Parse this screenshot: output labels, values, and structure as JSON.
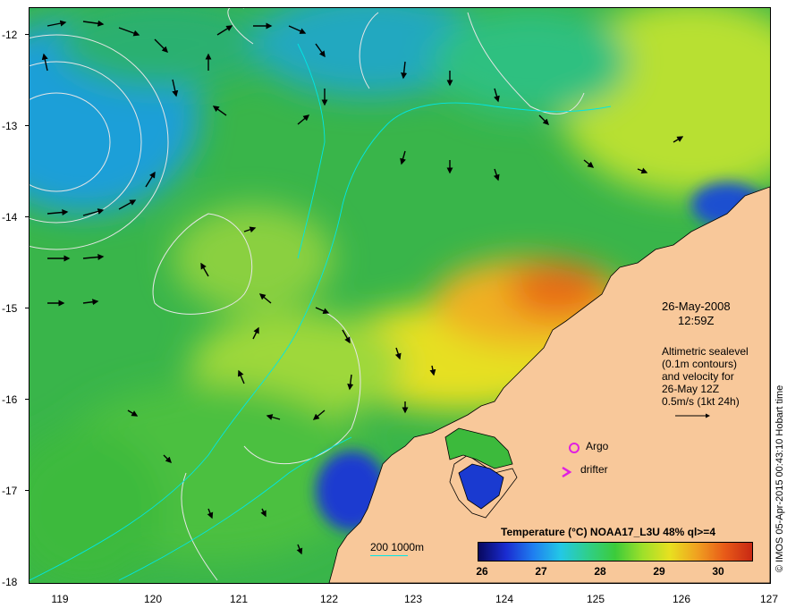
{
  "map": {
    "date": "26-May-2008",
    "time": "12:59Z",
    "altimetry_note": [
      "Altimetric sealevel",
      "(0.1m contours)",
      "and velocity for",
      "26-May 12Z",
      "0.5m/s (1kt 24h)"
    ],
    "legend": {
      "argo": "Argo",
      "drifter": "drifter",
      "argo_color": "#e020e0"
    },
    "colorbar": {
      "title": "Temperature (°C) NOAA17_L3U 48% ql>=4",
      "ticks": [
        "26",
        "27",
        "28",
        "29",
        "30"
      ]
    },
    "depth_scale_label": "200  1000m",
    "credit": "© IMOS 05-Apr-2015 00:43:10 Hobart time",
    "x_ticks": [
      "119",
      "120",
      "121",
      "122",
      "123",
      "124",
      "125",
      "126",
      "127"
    ],
    "y_ticks": [
      "-12",
      "-13",
      "-14",
      "-15",
      "-16",
      "-17",
      "-18"
    ],
    "colors": {
      "land": "#f8c89a",
      "sea_base": "#39b54a",
      "warm": "#f0a020",
      "cool": "#1f7ef0",
      "contour": "#e6e6e6",
      "isobath": "#00e6e6"
    }
  }
}
